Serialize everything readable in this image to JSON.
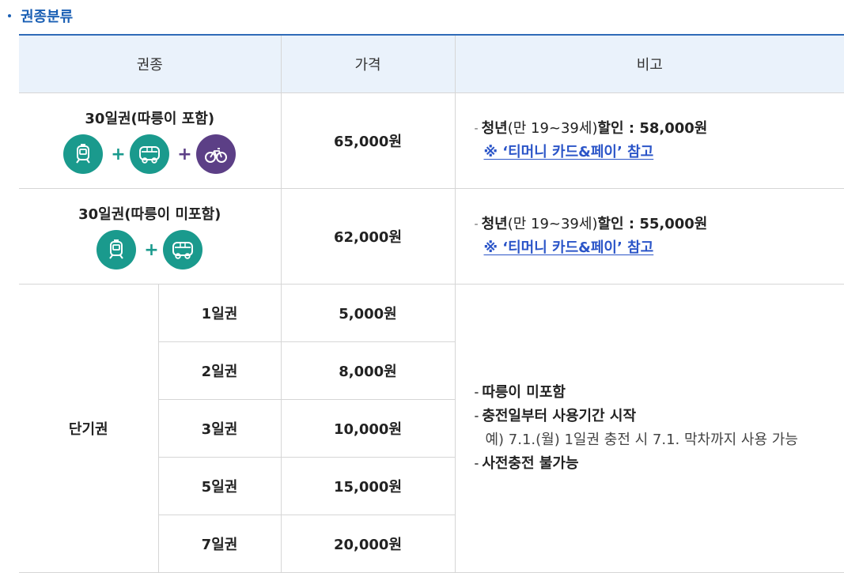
{
  "section": {
    "title": "권종분류"
  },
  "headers": {
    "type": "권종",
    "price": "가격",
    "note": "비고"
  },
  "rows": {
    "monthly_incl": {
      "name": "30일권(따릉이 포함)",
      "price": "65,000원",
      "discount_label": "청년",
      "discount_age": "(만 19~39세)",
      "discount_text": "할인 : 58,000원",
      "link": "※ ‘티머니 카드&페이’ 참고"
    },
    "monthly_excl": {
      "name": "30일권(따릉이 미포함)",
      "price": "62,000원",
      "discount_label": "청년",
      "discount_age": "(만 19~39세)",
      "discount_text": "할인 : 55,000원",
      "link": "※ ‘티머니 카드&페이’ 참고"
    },
    "short_term": {
      "group": "단기권",
      "items": [
        {
          "name": "1일권",
          "price": "5,000원"
        },
        {
          "name": "2일권",
          "price": "8,000원"
        },
        {
          "name": "3일권",
          "price": "10,000원"
        },
        {
          "name": "5일권",
          "price": "15,000원"
        },
        {
          "name": "7일권",
          "price": "20,000원"
        }
      ],
      "notes": {
        "n1": "따릉이 미포함",
        "n2": "충전일부터 사용기간 시작",
        "example": "예) 7.1.(월) 1일권 충전 시 7.1. 막차까지 사용 가능",
        "n3": "사전충전 불가능"
      }
    }
  },
  "icons": [
    "subway-icon",
    "bus-icon",
    "bicycle-icon"
  ],
  "colors": {
    "accent": "#1a5fb4",
    "teal": "#1a9a8d",
    "purple": "#5c3f86",
    "link": "#2b55c8",
    "header_bg": "#eaf2fb"
  }
}
